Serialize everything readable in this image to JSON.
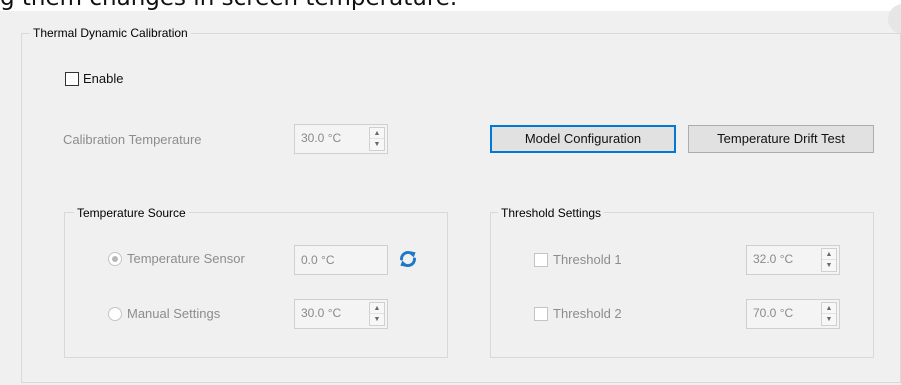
{
  "banner": {
    "text": "g them changes in screen temperature."
  },
  "main_group": {
    "title": "Thermal Dynamic Calibration",
    "enable": {
      "label": "Enable",
      "checked": false
    },
    "calibration_temperature": {
      "label": "Calibration Temperature",
      "value": "30.0 °C"
    },
    "buttons": {
      "model_configuration": "Model Configuration",
      "temperature_drift_test": "Temperature Drift Test"
    }
  },
  "temperature_source": {
    "title": "Temperature Source",
    "sensor": {
      "label": "Temperature Sensor",
      "value": "0.0 °C",
      "selected": true,
      "icon": "refresh-icon"
    },
    "manual": {
      "label": "Manual Settings",
      "value": "30.0 °C",
      "selected": false
    }
  },
  "threshold_settings": {
    "title": "Threshold Settings",
    "threshold1": {
      "label": "Threshold 1",
      "value": "32.0 °C",
      "checked": false
    },
    "threshold2": {
      "label": "Threshold 2",
      "value": "70.0 °C",
      "checked": false
    }
  },
  "colors": {
    "accent": "#0078d7",
    "refresh_icon": "#1e78c8",
    "disabled_text": "#8d8d8d"
  }
}
